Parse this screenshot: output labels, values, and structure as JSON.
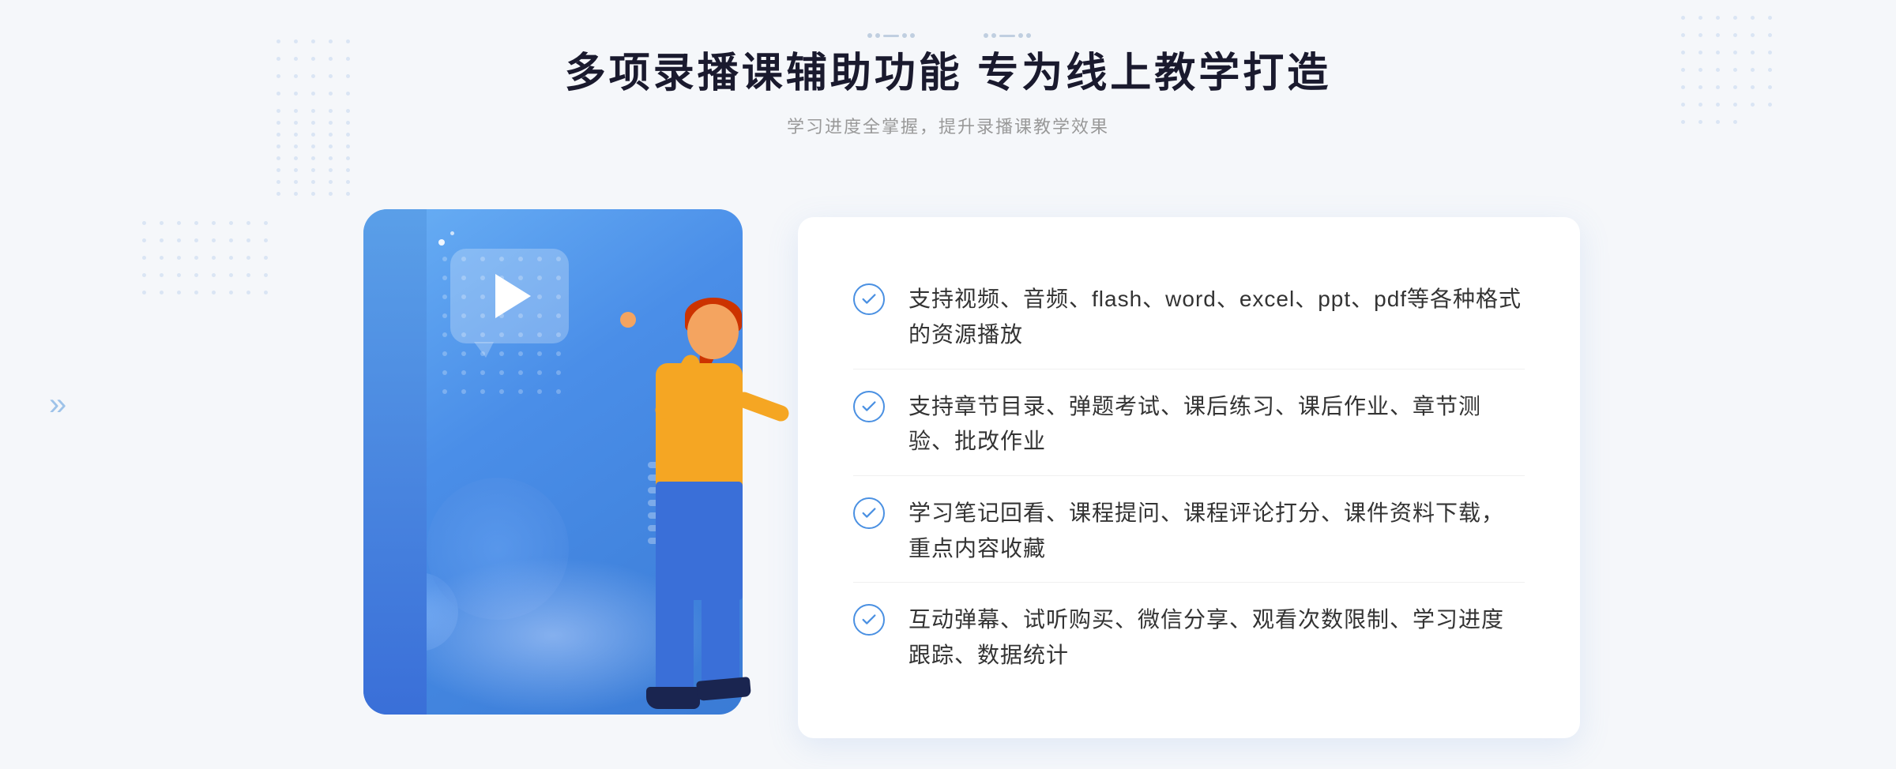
{
  "page": {
    "background": "#f5f7fa"
  },
  "header": {
    "main_title": "多项录播课辅助功能 专为线上教学打造",
    "sub_title": "学习进度全掌握，提升录播课教学效果"
  },
  "features": [
    {
      "id": "feature-1",
      "text": "支持视频、音频、flash、word、excel、ppt、pdf等各种格式的资源播放"
    },
    {
      "id": "feature-2",
      "text": "支持章节目录、弹题考试、课后练习、课后作业、章节测验、批改作业"
    },
    {
      "id": "feature-3",
      "text": "学习笔记回看、课程提问、课程评论打分、课件资料下载，重点内容收藏"
    },
    {
      "id": "feature-4",
      "text": "互动弹幕、试听购买、微信分享、观看次数限制、学习进度跟踪、数据统计"
    }
  ]
}
